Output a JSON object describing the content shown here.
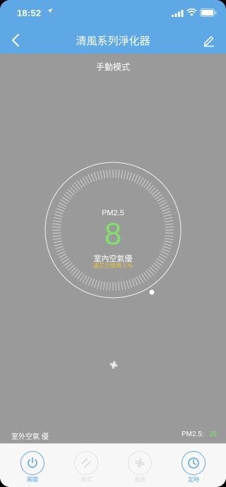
{
  "status_bar": {
    "time": "18:52"
  },
  "nav": {
    "title": "清風系列淨化器"
  },
  "main": {
    "mode": "手動模式",
    "pm_label": "PM2.5",
    "pm_value": "8",
    "air_quality": "室內空氣優",
    "filter_usage": "濾芯已使用 0 %"
  },
  "outdoor": {
    "label": "室外空氣 優",
    "pm_label": "PM2.5:",
    "pm_value": "35"
  },
  "tabs": [
    {
      "label": "開關",
      "icon": "power-icon",
      "enabled": true
    },
    {
      "label": "模式",
      "icon": "mode-icon",
      "enabled": false
    },
    {
      "label": "風速",
      "icon": "fan-icon",
      "enabled": false
    },
    {
      "label": "定時",
      "icon": "clock-icon",
      "enabled": true
    }
  ],
  "colors": {
    "header": "#5fa8e6",
    "background": "#9a9a9a",
    "pm_value": "#7fe06a",
    "filter_text": "#e8c33a"
  }
}
